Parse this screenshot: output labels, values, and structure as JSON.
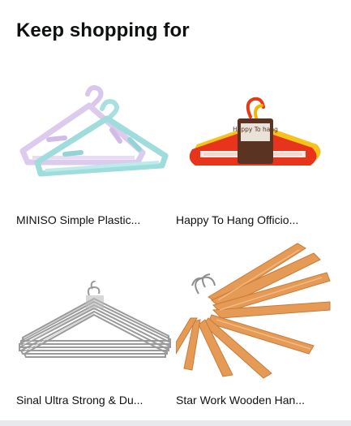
{
  "section": {
    "title": "Keep shopping for"
  },
  "products": [
    {
      "name": "MINISO Simple Plastic...",
      "image": "pastel-plastic-hangers-image"
    },
    {
      "name": "Happy To Hang Officio...",
      "image": "red-yellow-hangers-image",
      "package_text": "Happy To hang"
    },
    {
      "name": "Sinal Ultra Strong & Du...",
      "image": "steel-wire-hangers-image"
    },
    {
      "name": "Star Work Wooden Han...",
      "image": "wooden-hangers-image"
    }
  ],
  "colors": {
    "background": "#ffffff",
    "text": "#0f1111",
    "footer_strip": "#e7e9ec"
  }
}
